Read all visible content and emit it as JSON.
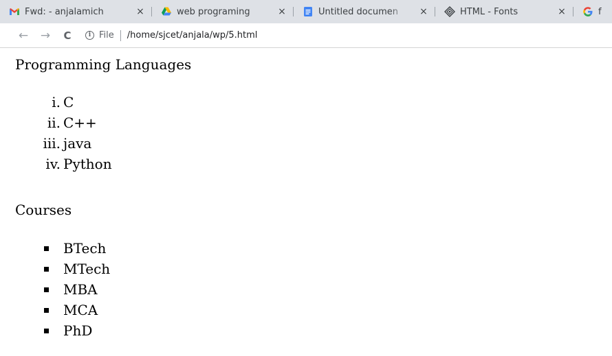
{
  "browser": {
    "tabs": [
      {
        "title": "Fwd: - anjalamich",
        "icon": "gmail-icon"
      },
      {
        "title": "web programing",
        "icon": "google-drive-icon"
      },
      {
        "title": "Untitled documen",
        "icon": "google-docs-icon"
      },
      {
        "title": "HTML - Fonts",
        "icon": "tutorialspoint-icon"
      },
      {
        "title": "f",
        "icon": "google-icon"
      }
    ],
    "close_glyph": "×",
    "nav": {
      "back": "←",
      "forward": "→",
      "reload": "C"
    },
    "omnibox": {
      "info_glyph": "i",
      "scheme": "File",
      "url": "/home/sjcet/anjala/wp/5.html"
    }
  },
  "page": {
    "section1": {
      "heading": "Programming Languages",
      "markers": [
        "i.",
        "ii.",
        "iii.",
        "iv."
      ],
      "items": [
        "C",
        "C++",
        "java",
        "Python"
      ]
    },
    "section2": {
      "heading": "Courses",
      "items": [
        "BTech",
        "MTech",
        "MBA",
        "MCA",
        "PhD"
      ]
    }
  },
  "colors": {
    "tabstrip": "#dee1e6",
    "text": "#000000",
    "chrome_text": "#3c4043"
  }
}
